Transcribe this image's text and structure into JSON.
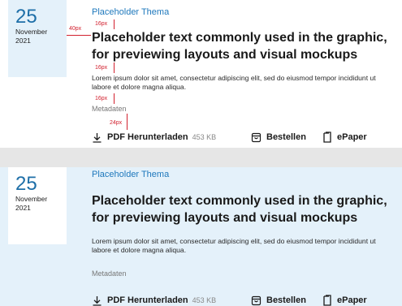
{
  "cards": [
    {
      "date": {
        "day": "25",
        "month": "November",
        "year": "2021"
      },
      "thema": "Placeholder Thema",
      "headline": "Placeholder text commonly used in the graphic, for previewing layouts and visual mockups",
      "body": "Lorem ipsum dolor sit amet, consectetur adipiscing elit, sed do eiusmod tempor incididunt ut labore et dolore magna aliqua.",
      "meta": "Metadaten",
      "actions": {
        "pdf_label": "PDF Herunterladen",
        "pdf_size": "453 KB",
        "order_label": "Bestellen",
        "epaper_label": "ePaper"
      }
    },
    {
      "date": {
        "day": "25",
        "month": "November",
        "year": "2021"
      },
      "thema": "Placeholder Thema",
      "headline": "Placeholder text commonly used in the graphic, for previewing layouts and visual mockups",
      "body": "Lorem ipsum dolor sit amet, consectetur adipiscing elit, sed do eiusmod tempor incididunt ut labore et dolore magna aliqua.",
      "meta": "Metadaten",
      "actions": {
        "pdf_label": "PDF Herunterladen",
        "pdf_size": "453 KB",
        "order_label": "Bestellen",
        "epaper_label": "ePaper"
      }
    }
  ],
  "annotations": {
    "gap_40": "40px",
    "gap_16_a": "16px",
    "gap_16_b": "16px",
    "gap_16_c": "16px",
    "gap_24": "24px"
  },
  "colors": {
    "accent": "#1e78bc",
    "date_bg": "#e4f1fa",
    "annotation": "#d2202e"
  }
}
